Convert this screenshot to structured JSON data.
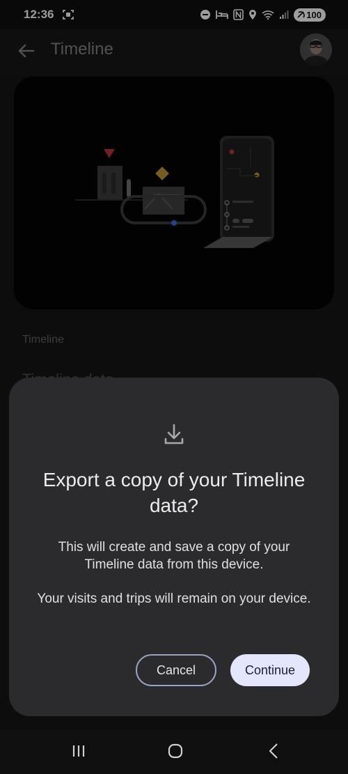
{
  "status_bar": {
    "time": "12:36",
    "battery": "100"
  },
  "app_bar": {
    "title": "Timeline"
  },
  "background": {
    "section_label": "Timeline",
    "partial_item": "Timeline data"
  },
  "dialog": {
    "title": "Export a copy of your Timeline data?",
    "body_1": "This will create and save a copy of your Timeline data from this device.",
    "body_2": "Your visits and trips will remain on your device.",
    "cancel_label": "Cancel",
    "continue_label": "Continue"
  },
  "colors": {
    "dialog_bg": "#2b2b2e",
    "continue_bg": "#e4e6fb",
    "cancel_border": "#9aa3c2"
  },
  "icons": [
    "back-arrow-icon",
    "download-icon",
    "recent-apps-icon",
    "home-icon",
    "nav-back-icon"
  ]
}
